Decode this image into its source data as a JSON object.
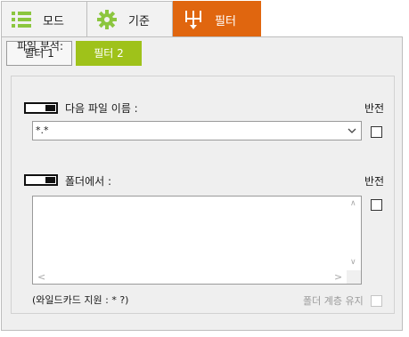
{
  "tabs": {
    "mode": "모드",
    "criteria": "기준",
    "filter": "필터"
  },
  "subtabs": {
    "filter1": "필터 1",
    "filter2": "필터 2"
  },
  "group": {
    "title": "파일 분석:"
  },
  "file_name": {
    "label": "다음 파일 이름 :",
    "value": "*.*",
    "invert_label": "반전"
  },
  "folder": {
    "label": "폴더에서 :",
    "invert_label": "반전"
  },
  "footer": {
    "wildcard_note": "(와일드카드 지원 : * ?)",
    "keep_hierarchy_label": "폴더 계층 유지"
  },
  "colors": {
    "filter_tab": "#e0660f",
    "active_subtab": "#9fc21a",
    "list_icon": "#8cc63f"
  }
}
